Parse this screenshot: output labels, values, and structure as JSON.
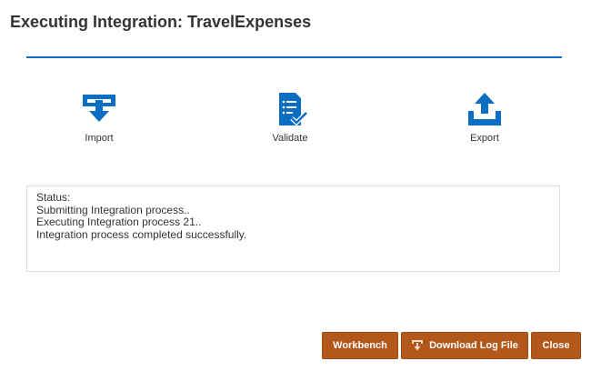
{
  "dialog": {
    "title": "Executing Integration: TravelExpenses"
  },
  "colors": {
    "accent_blue": "#0a6fc2",
    "button_brown": "#b3581a"
  },
  "steps": [
    {
      "label": "Import",
      "icon": "import-icon"
    },
    {
      "label": "Validate",
      "icon": "validate-icon"
    },
    {
      "label": "Export",
      "icon": "export-icon"
    }
  ],
  "status": {
    "lines": [
      "Status:",
      "Submitting Integration process..",
      "Executing Integration process 21..",
      "Integration process completed successfully."
    ]
  },
  "buttons": {
    "workbench": "Workbench",
    "download_log": "Download Log File",
    "close": "Close"
  }
}
